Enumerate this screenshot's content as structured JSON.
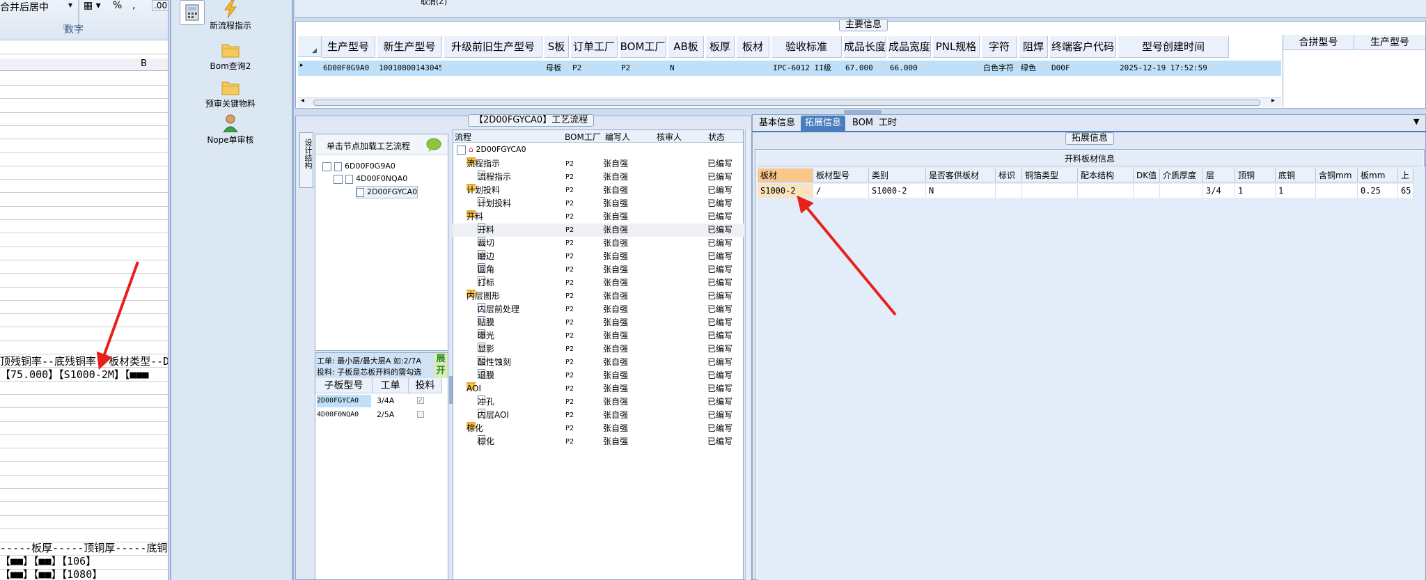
{
  "excel": {
    "ribbon_merge_label": "合并后居中",
    "percent_symbol": "%",
    "number_group_label": "数字",
    "column_b_header": "B",
    "line1": "顶残铜率--底残铜率--板材类型--D",
    "line2": "【75.000】【S1000-2M】【■■■",
    "line3": "-----板厚-----顶铜厚-----底铜厚",
    "line4": "【■■】【■■】【106】",
    "line5": "【■■】【■■】【1080】"
  },
  "toolbar": {
    "items": [
      "新流程指示",
      "Bom查询2",
      "预审关键物料",
      "Nope单审核"
    ]
  },
  "top_strip_text": "取消(Z)",
  "main_info": {
    "caption": "主要信息",
    "columns": [
      "生产型号",
      "新生产型号",
      "升级前旧生产型号",
      "S板",
      "订单工厂",
      "BOM工厂",
      "AB板",
      "板厚",
      "板材",
      "验收标准",
      "成品长度",
      "成品宽度",
      "PNL规格",
      "字符",
      "阻焊",
      "终端客户代码",
      "型号创建时间"
    ],
    "row": [
      "6D00F0G9A0",
      "10010800143045",
      "",
      "母板",
      "P2",
      "P2",
      "N",
      "",
      "",
      "IPC-6012 II级",
      "67.000",
      "66.000",
      "",
      "白色字符",
      "绿色",
      "D00F",
      "2025-12-19 17:52:59"
    ],
    "side_columns": [
      "合拼型号",
      "生产型号"
    ]
  },
  "process": {
    "caption": "【2D00FGYCA0】工艺流程",
    "vertical_tab": "设计结构",
    "load_hint": "单击节点加载工艺流程",
    "tree": [
      "6D00F0G9A0",
      "4D00F0NQA0",
      "2D00FGYCA0"
    ],
    "note1": "工单: 最小层/最大层A 如:2/7A",
    "note2": "投料: 子板是芯板开料的需勾选",
    "expand_label": "展开",
    "sub_headers": [
      "子板型号",
      "工单",
      "投料"
    ],
    "sub_rows": [
      {
        "model": "2D00FGYCA0",
        "order": "3/4A",
        "checked": true
      },
      {
        "model": "4D00F0NQA0",
        "order": "2/5A",
        "checked": false
      }
    ],
    "grid_headers": [
      "流程",
      "BOM工厂",
      "编写人",
      "核审人",
      "状态"
    ],
    "root": "2D00FGYCA0",
    "steps": [
      {
        "name": "流程指示",
        "level": 1,
        "factory": "P2",
        "author": "张自强",
        "status": "已编写"
      },
      {
        "name": "流程指示",
        "level": 2,
        "factory": "P2",
        "author": "张自强",
        "status": "已编写"
      },
      {
        "name": "计划投料",
        "level": 1,
        "factory": "P2",
        "author": "张自强",
        "status": "已编写"
      },
      {
        "name": "计划投料",
        "level": 2,
        "factory": "P2",
        "author": "张自强",
        "status": "已编写"
      },
      {
        "name": "开料",
        "level": 1,
        "factory": "P2",
        "author": "张自强",
        "status": "已编写"
      },
      {
        "name": "开料",
        "level": 2,
        "factory": "P2",
        "author": "张自强",
        "status": "已编写"
      },
      {
        "name": "裁切",
        "level": 2,
        "factory": "P2",
        "author": "张自强",
        "status": "已编写"
      },
      {
        "name": "磨边",
        "level": 2,
        "factory": "P2",
        "author": "张自强",
        "status": "已编写"
      },
      {
        "name": "圆角",
        "level": 2,
        "factory": "P2",
        "author": "张自强",
        "status": "已编写"
      },
      {
        "name": "打标",
        "level": 2,
        "factory": "P2",
        "author": "张自强",
        "status": "已编写"
      },
      {
        "name": "内层图形",
        "level": 1,
        "factory": "P2",
        "author": "张自强",
        "status": "已编写"
      },
      {
        "name": "内层前处理",
        "level": 2,
        "factory": "P2",
        "author": "张自强",
        "status": "已编写"
      },
      {
        "name": "贴膜",
        "level": 2,
        "factory": "P2",
        "author": "张自强",
        "status": "已编写"
      },
      {
        "name": "曝光",
        "level": 2,
        "factory": "P2",
        "author": "张自强",
        "status": "已编写"
      },
      {
        "name": "显影",
        "level": 2,
        "factory": "P2",
        "author": "张自强",
        "status": "已编写"
      },
      {
        "name": "酸性蚀刻",
        "level": 2,
        "factory": "P2",
        "author": "张自强",
        "status": "已编写"
      },
      {
        "name": "退膜",
        "level": 2,
        "factory": "P2",
        "author": "张自强",
        "status": "已编写"
      },
      {
        "name": "AOI",
        "level": 1,
        "factory": "P2",
        "author": "张自强",
        "status": "已编写"
      },
      {
        "name": "冲孔",
        "level": 2,
        "factory": "P2",
        "author": "张自强",
        "status": "已编写"
      },
      {
        "name": "内层AOI",
        "level": 2,
        "factory": "P2",
        "author": "张自强",
        "status": "已编写"
      },
      {
        "name": "棕化",
        "level": 1,
        "factory": "P2",
        "author": "张自强",
        "status": "已编写"
      },
      {
        "name": "棕化",
        "level": 2,
        "factory": "P2",
        "author": "张自强",
        "status": "已编写"
      }
    ]
  },
  "detail": {
    "tabs": [
      "基本信息",
      "拓展信息",
      "BOM",
      "工时"
    ],
    "active_tab": "拓展信息",
    "caption": "拓展信息",
    "grid_title": "开料板材信息",
    "columns": [
      "板材",
      "板材型号",
      "类别",
      "是否客供板材",
      "标识",
      "铜箔类型",
      "配本结构",
      "DK值",
      "介质厚度",
      "层",
      "顶铜",
      "底铜",
      "含铜mm",
      "板mm",
      "上"
    ],
    "row": [
      "S1000-2",
      "/",
      "S1000-2",
      "N",
      "",
      "",
      "",
      "",
      "",
      "3/4",
      "1",
      "1",
      "",
      "0.25",
      "65"
    ]
  },
  "colors": {
    "annotation_arrow": "#e8201c",
    "selected_row": "#bfe0f8",
    "highlight_cell": "#f9c78a"
  }
}
